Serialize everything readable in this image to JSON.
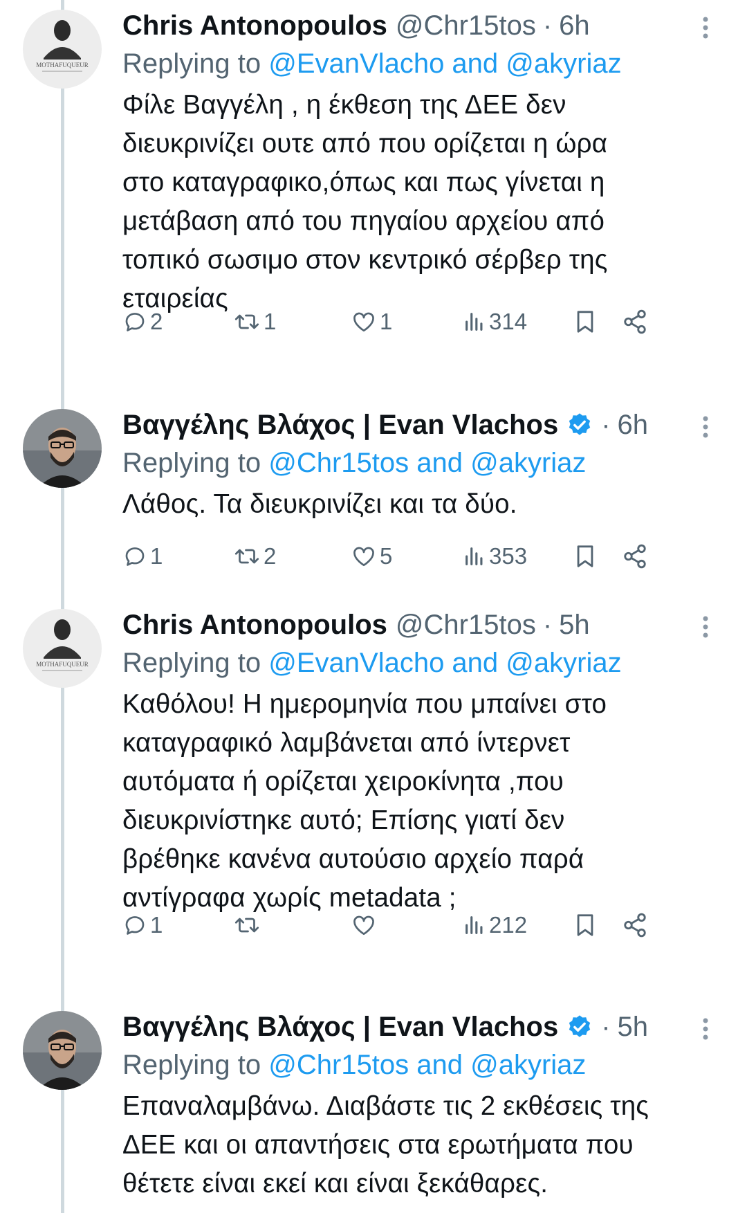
{
  "tweets": [
    {
      "name": "Chris Antonopoulos",
      "handle": "@Chr15tos",
      "time": "6h",
      "verified": false,
      "avatar_text": "MOTHAFUQUEUR",
      "reply_prefix": "Replying to ",
      "reply_mentions": "@EvanVlacho and @akyriaz",
      "body": "Φίλε Βαγγέλη , η έκθεση της ΔΕΕ δεν\nδιευκρινίζει ουτε  από που ορίζεται η ώρα\nστο καταγραφικο,όπως και πως γίνεται η\nμετάβαση από του πηγαίου αρχείου από\nτοπικό σωσιμο στον κεντρικό σέρβερ  της\nεταιρείας",
      "replies": "2",
      "retweets": "1",
      "likes": "1",
      "views": "314"
    },
    {
      "name": "Βαγγέλης Βλάχος | Evan Vlachos",
      "handle": "",
      "time": "6h",
      "verified": true,
      "reply_prefix": "Replying to ",
      "reply_mentions": "@Chr15tos and @akyriaz",
      "body": "Λάθος. Τα διευκρινίζει και τα δύο.",
      "replies": "1",
      "retweets": "2",
      "likes": "5",
      "views": "353"
    },
    {
      "name": "Chris Antonopoulos",
      "handle": "@Chr15tos",
      "time": "5h",
      "verified": false,
      "avatar_text": "MOTHAFUQUEUR",
      "reply_prefix": "Replying to ",
      "reply_mentions": "@EvanVlacho and @akyriaz",
      "body": "Καθόλου! Η ημερομηνία  που μπαίνει στο\nκαταγραφικό λαμβάνεται από ίντερνετ\nαυτόματα ή ορίζεται  χειροκίνητα ,που\nδιευκρινίστηκε αυτό; Επίσης γιατί δεν\nβρέθηκε κανένα αυτούσιο αρχείο παρά\nαντίγραφα χωρίς metadata ;",
      "replies": "1",
      "retweets": "",
      "likes": "",
      "views": "212"
    },
    {
      "name": "Βαγγέλης Βλάχος | Evan Vlachos",
      "handle": "",
      "time": "5h",
      "verified": true,
      "reply_prefix": "Replying to ",
      "reply_mentions": "@Chr15tos and @akyriaz",
      "body": "Επαναλαμβάνω. Διαβάστε τις 2 εκθέσεις της\nΔΕΕ και οι απαντήσεις στα ερωτήματα που\nθέτετε είναι εκεί και είναι ξεκάθαρες."
    }
  ],
  "separator": "·",
  "colors": {
    "text": "#0f1419",
    "secondary": "#536471",
    "accent": "#1d9bf0",
    "thread_line": "#cfd9de"
  },
  "icons": [
    "reply-icon",
    "retweet-icon",
    "like-icon",
    "views-icon",
    "bookmark-icon",
    "share-icon",
    "more-icon",
    "verified-icon"
  ]
}
